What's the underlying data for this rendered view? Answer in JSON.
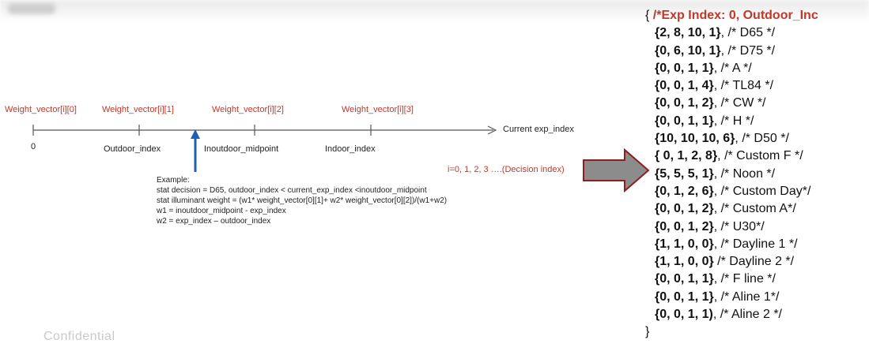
{
  "axis": {
    "weight_labels": [
      "Weight_vector[i][0]",
      "Weight_vector[i][1]",
      "Weight_vector[i][2]",
      "Weight_vector[i][3]"
    ],
    "tick_labels": [
      "0",
      "Outdoor_index",
      "Inoutdoor_midpoint",
      "Indoor_index"
    ],
    "end_label": "Current exp_index"
  },
  "example": {
    "title": "Example:",
    "lines": [
      "stat decision = D65,  outdoor_index < current_exp_index <inoutdoor_midpoint",
      "stat illuminant weight = (w1* weight_vector[0][1]+ w2* weight_vector[0][2])/(w1+w2)",
      "w1 = inoutdoor_midpoint - exp_index",
      "w2 = exp_index – outdoor_index"
    ]
  },
  "decision_label": "i=0, 1, 2, 3 ….(Decision index)",
  "code": {
    "open_brace": "{ ",
    "header_comment": "/*Exp Index: 0, Outdoor_Inc",
    "entries": [
      {
        "vals": "{2, 8, 10, 1}",
        "rest": ", /* D65 */"
      },
      {
        "vals": "{0, 6, 10, 1}",
        "rest": ", /* D75 */"
      },
      {
        "vals": "{0, 0, 1, 1}",
        "rest": ", /* A */"
      },
      {
        "vals": "{0, 0, 1, 4}",
        "rest": ", /* TL84 */"
      },
      {
        "vals": "{0, 0, 1, 2}",
        "rest": ", /* CW */"
      },
      {
        "vals": "{0, 0, 1, 1}",
        "rest": ", /* H */"
      },
      {
        "vals": "{10, 10, 10, 6}",
        "rest": ", /* D50 */"
      },
      {
        "vals": "{ 0, 1, 2, 8}",
        "rest": ", /* Custom F */"
      },
      {
        "vals": "{5, 5, 5, 1}",
        "rest": ", /* Noon */"
      },
      {
        "vals": "{0, 1, 2, 6}",
        "rest": ", /* Custom Day*/"
      },
      {
        "vals": "{0, 0, 1, 2}",
        "rest": ", /* Custom A*/"
      },
      {
        "vals": "{0, 0, 1, 2}",
        "rest": ", /* U30*/"
      },
      {
        "vals": "{1, 1, 0, 0}",
        "rest": ", /* Dayline 1 */"
      },
      {
        "vals": "{1, 1, 0, 0}",
        "rest": " /* Dayline 2 */"
      },
      {
        "vals": "{0, 0, 1, 1}",
        "rest": ", /* F line */"
      },
      {
        "vals": "{0, 0, 1, 1}",
        "rest": ", /* Aline 1*/"
      },
      {
        "vals": "{0, 0, 1, 1)",
        "rest": ", /* Aline 2 */"
      }
    ],
    "close_brace": "}"
  },
  "watermark": "Confidential",
  "colors": {
    "label_red": "#c0392b",
    "arrow_blue": "#1f5fb4",
    "arrow_gray": "#8c8c8c",
    "arrow_dark_red": "#8b1f1f",
    "axis": "#555555"
  }
}
